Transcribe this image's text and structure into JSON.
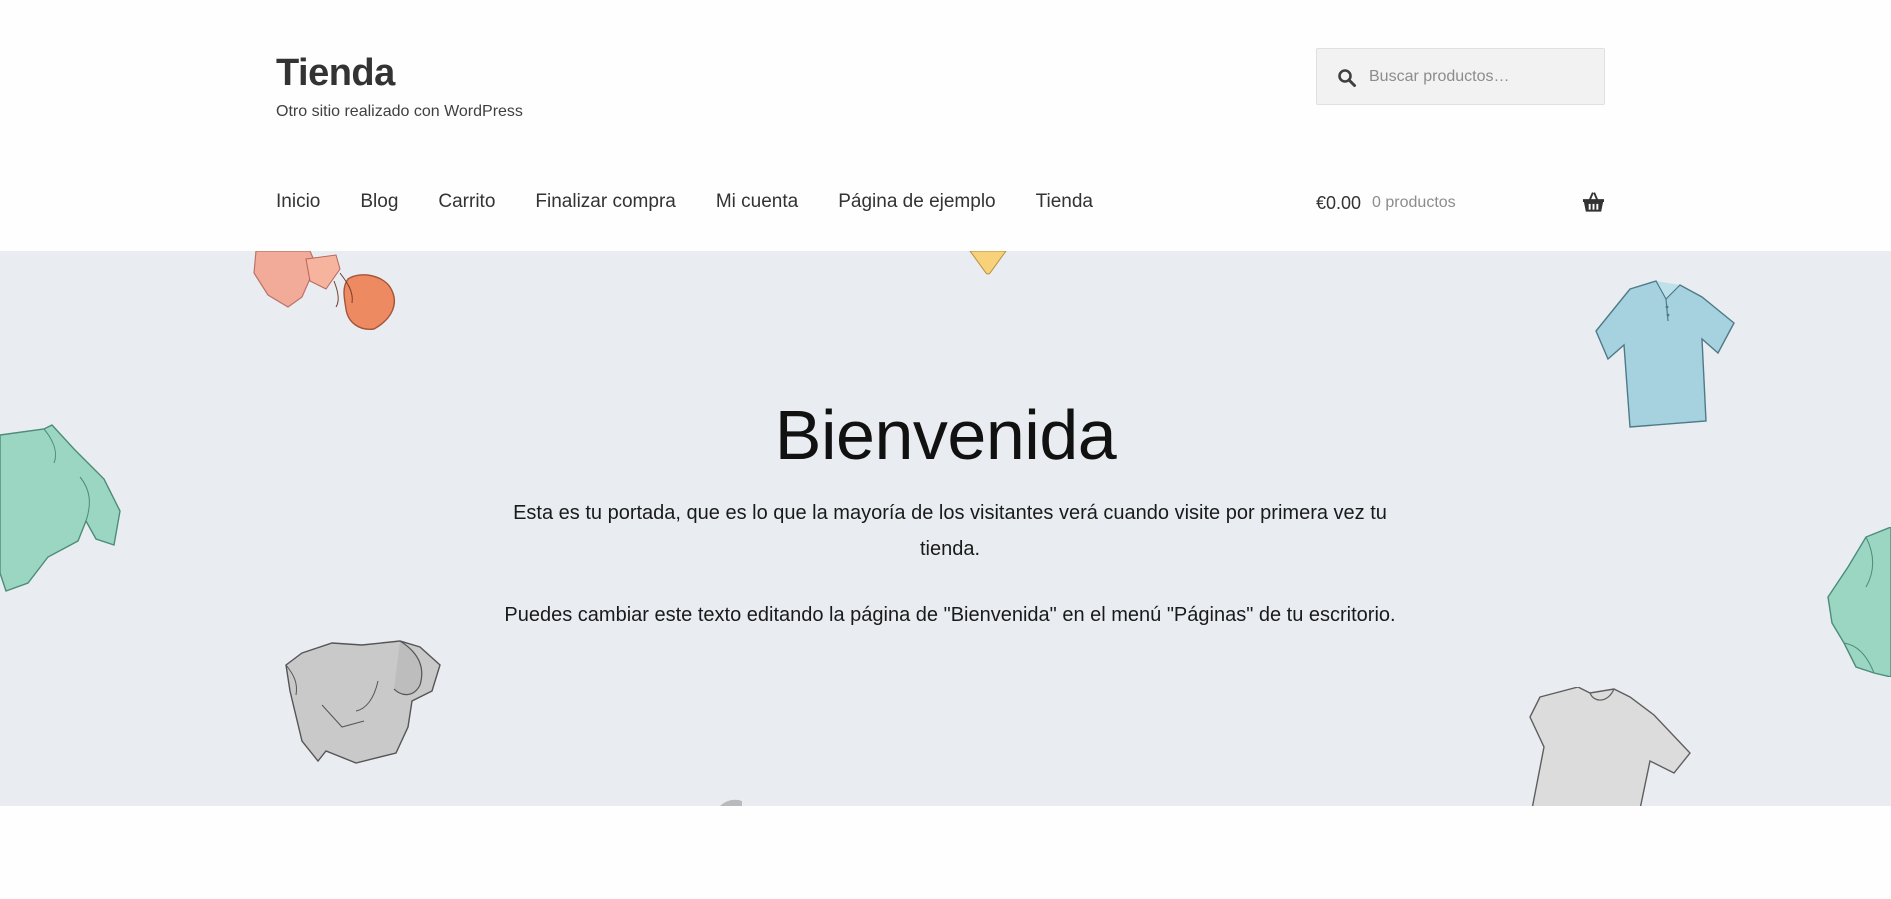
{
  "site": {
    "title": "Tienda",
    "description": "Otro sitio realizado con WordPress"
  },
  "search": {
    "placeholder": "Buscar productos…",
    "icon": "search-icon"
  },
  "nav": {
    "items": [
      {
        "label": "Inicio"
      },
      {
        "label": "Blog"
      },
      {
        "label": "Carrito"
      },
      {
        "label": "Finalizar compra"
      },
      {
        "label": "Mi cuenta"
      },
      {
        "label": "Página de ejemplo"
      },
      {
        "label": "Tienda"
      }
    ]
  },
  "cart": {
    "amount": "€0.00",
    "count": "0 productos",
    "icon": "basket-icon"
  },
  "hero": {
    "title": "Bienvenida",
    "paragraph1": "Esta es tu portada, que es lo que la mayoría de los visitantes verá cuando visite por primera vez tu tienda.",
    "paragraph2": "Puedes cambiar este texto editando la página de \"Bienvenida\" en el menú \"Páginas\" de tu escritorio.",
    "background_color": "#e9edf1"
  },
  "colors": {
    "text": "#333333",
    "muted": "#8c8c8c",
    "search_bg": "#f2f2f2"
  }
}
